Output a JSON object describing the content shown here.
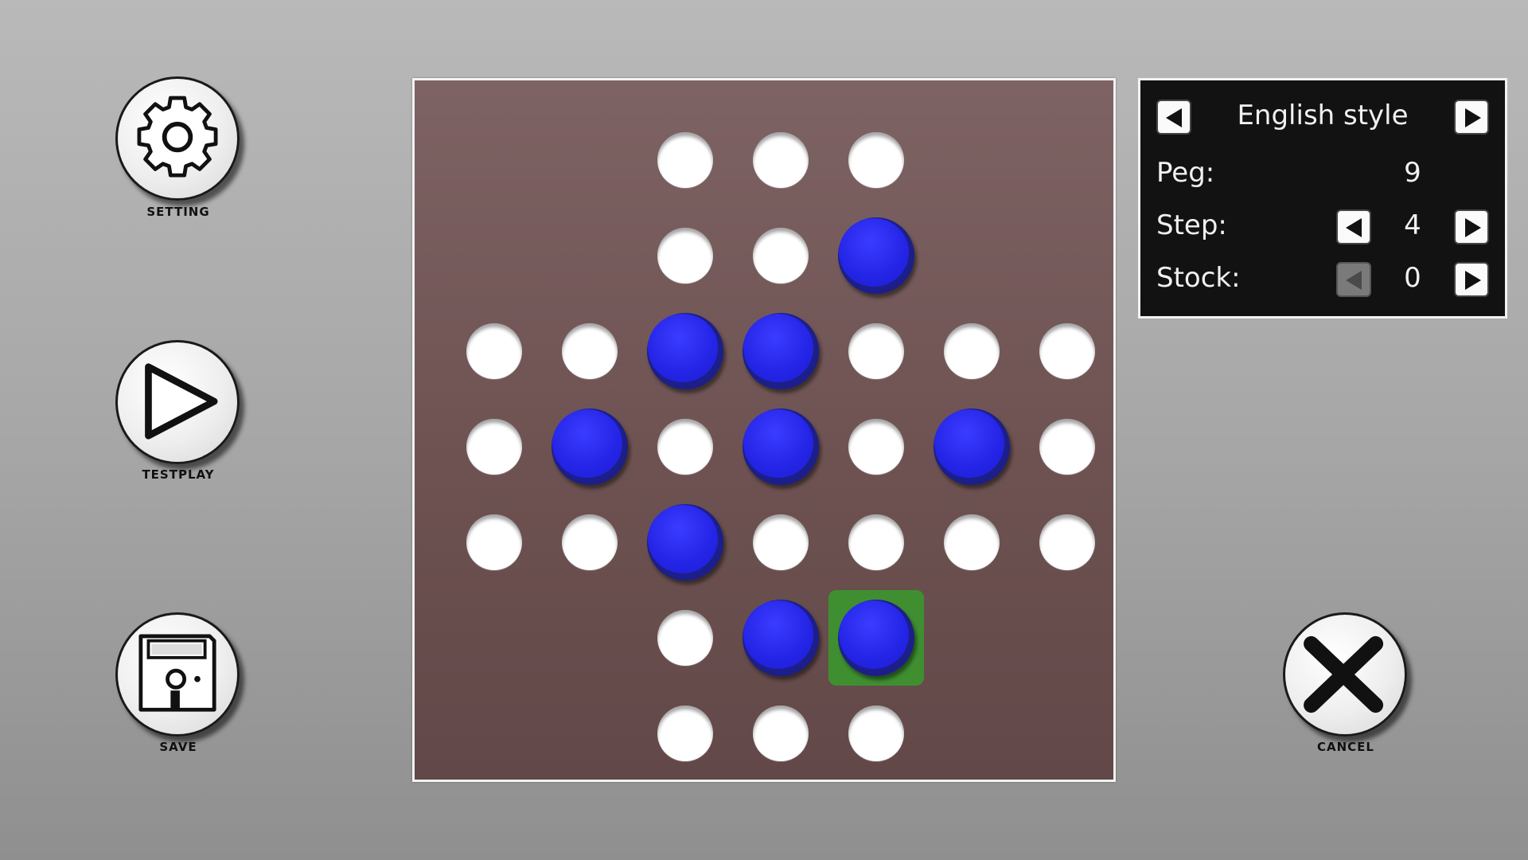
{
  "toolbar": {
    "setting_label": "SETTING",
    "testplay_label": "TESTPLAY",
    "save_label": "SAVE",
    "cancel_label": "CANCEL"
  },
  "panel": {
    "style_name": "English style",
    "peg_label": "Peg:",
    "peg_value": "9",
    "step_label": "Step:",
    "step_value": "4",
    "stock_label": "Stock:",
    "stock_value": "0"
  },
  "board": {
    "pegs": [
      [
        null,
        null,
        "hole",
        "hole",
        "hole",
        null,
        null
      ],
      [
        null,
        null,
        "hole",
        "hole",
        "peg",
        null,
        null
      ],
      [
        "hole",
        "hole",
        "peg",
        "peg",
        "hole",
        "hole",
        "hole"
      ],
      [
        "hole",
        "peg",
        "hole",
        "peg",
        "hole",
        "peg",
        "hole"
      ],
      [
        "hole",
        "hole",
        "peg",
        "hole",
        "hole",
        "hole",
        "hole"
      ],
      [
        null,
        null,
        "hole",
        "peg",
        "peg",
        null,
        null
      ],
      [
        null,
        null,
        "hole",
        "hole",
        "hole",
        null,
        null
      ]
    ],
    "selected": [
      5,
      4
    ]
  },
  "colors": {
    "peg": "#2424e6",
    "selection": "#3f8f31",
    "board": "#6e5252"
  },
  "icons": {
    "setting": "gear-icon",
    "testplay": "play-icon",
    "save": "floppy-disk-icon",
    "cancel": "close-icon"
  }
}
